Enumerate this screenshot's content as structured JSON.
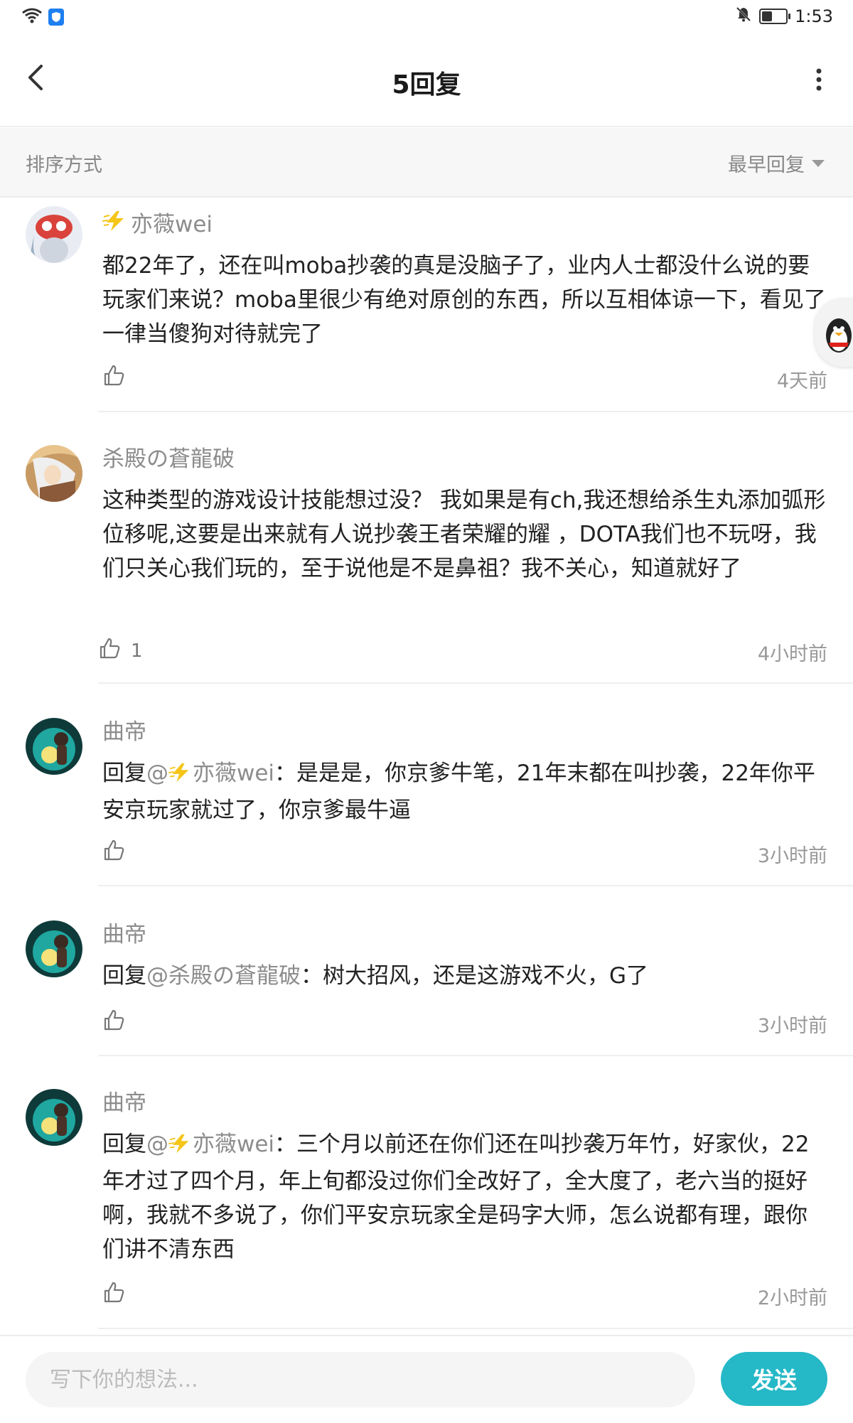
{
  "status_bar": {
    "time": "1:53"
  },
  "header": {
    "title": "5回复"
  },
  "sort": {
    "label": "排序方式",
    "value": "最早回复"
  },
  "comments": [
    {
      "user": "亦薇wei",
      "text": "都22年了，还在叫moba抄袭的真是没脑子了，业内人士都没什么说的要玩家们来说？moba里很少有绝对原创的东西，所以互相体谅一下，看见了一律当傻狗对待就完了",
      "likes": "",
      "time": "4天前"
    },
    {
      "user": "杀殿の蒼龍破",
      "text": "这种类型的游戏设计技能想过没？ 我如果是有ch,我还想给杀生丸添加弧形位移呢,这要是出来就有人说抄袭王者荣耀的耀 ，DOTA我们也不玩呀，我们只关心我们玩的，至于说他是不是鼻祖？我不关心，知道就好了",
      "likes": "1",
      "time": "4小时前"
    },
    {
      "user": "曲帝",
      "reply_prefix": "回复",
      "mention": "@亦薇wei",
      "text": "：是是是，你京爹牛笔，21年末都在叫抄袭，22年你平安京玩家就过了，你京爹最牛逼",
      "likes": "",
      "time": "3小时前"
    },
    {
      "user": "曲帝",
      "reply_prefix": "回复",
      "mention": "@杀殿の蒼龍破",
      "text": "：树大招风，还是这游戏不火，G了",
      "likes": "",
      "time": "3小时前"
    },
    {
      "user": "曲帝",
      "reply_prefix": "回复",
      "mention": "@亦薇wei",
      "text": "：三个月以前还在你们还在叫抄袭万年竹，好家伙，22年才过了四个月，年上旬都没过你们全改好了，全大度了，老六当的挺好啊，我就不多说了，你们平安京玩家全是码字大师，怎么说都有理，跟你们讲不清东西",
      "likes": "",
      "time": "2小时前"
    }
  ],
  "footer": {
    "placeholder": "写下你的想法...",
    "send_label": "发送"
  },
  "icons": {
    "wifi": "wifi-icon",
    "vpn": "shield-icon",
    "mute": "bell-off-icon",
    "battery": "battery-icon",
    "back": "back-arrow-icon",
    "more": "more-vertical-icon",
    "like": "thumbs-up-icon",
    "badge": "lightning-badge-icon",
    "qq": "qq-penguin-icon"
  },
  "colors": {
    "accent": "#25b8c7",
    "vpn_blue": "#1e7ff0",
    "badge_yellow": "#f5c518"
  }
}
